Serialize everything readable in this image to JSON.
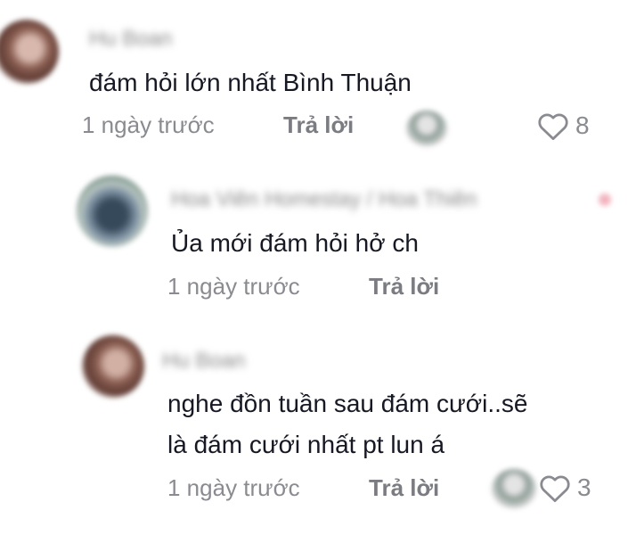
{
  "comments": [
    {
      "username": "Hu Boan",
      "text": "đám hỏi lớn nhất Bình Thuận",
      "time": "1 ngày trước",
      "reply_label": "Trả lời",
      "likes": "8",
      "liked": false,
      "replies": [
        {
          "username": "Hoa Viên Homestay / Hoa Thiên",
          "lines": [
            "Ủa mới đám hỏi hở ch"
          ],
          "time": "1 ngày trước",
          "reply_label": "Trả lời"
        },
        {
          "username": "Hu Boan",
          "lines": [
            "nghe đồn tuần sau đám cưới..sẽ",
            "là đám cưới nhất pt lun á"
          ],
          "time": "1 ngày trước",
          "reply_label": "Trả lời",
          "likes": "3",
          "liked": false
        }
      ]
    }
  ],
  "colors": {
    "text": "#161823",
    "secondary": "#8a8b91",
    "heart_outline": "#8a8b91"
  },
  "icons": {
    "like": "heart-outline-icon"
  }
}
